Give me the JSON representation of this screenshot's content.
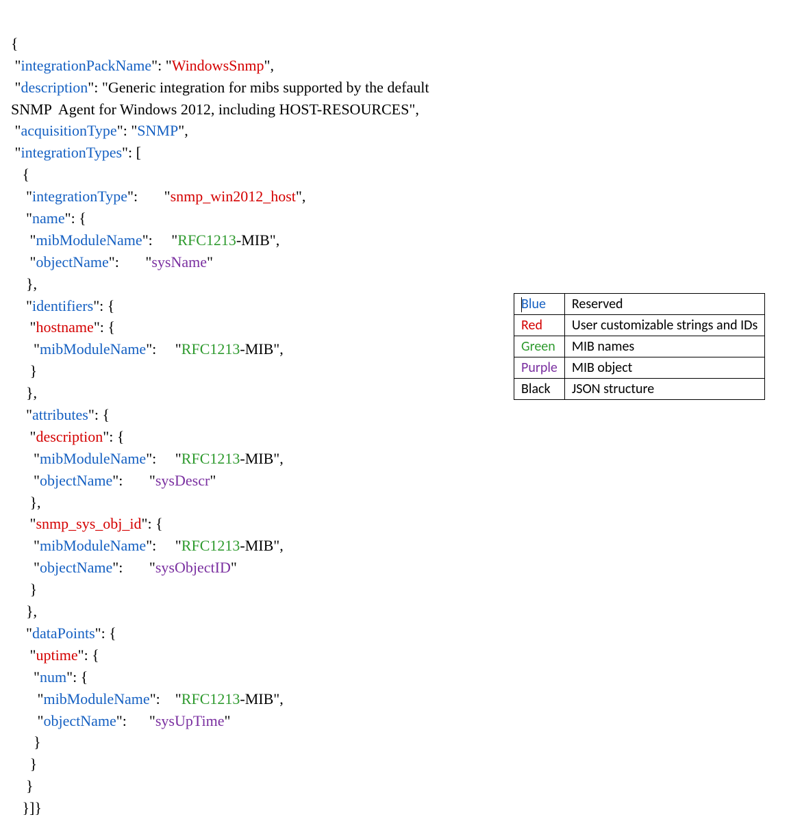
{
  "code": {
    "l1": "{",
    "l2_key": "integrationPackName",
    "l2_val": "WindowsSnmp",
    "l3_key": "description",
    "l3_val_a": "Generic integration for mibs supported by the default",
    "l3_val_b": "SNMP  Agent for Windows 2012, including HOST-RESOURCES",
    "l5_key": "acquisitionType",
    "l5_val": "SNMP",
    "l6_key": "integrationTypes",
    "l8_key": "integrationType",
    "l8_val": "snmp_win2012_host",
    "l9_key": "name",
    "mibModuleName_key": "mibModuleName",
    "objectName_key": "objectName",
    "mib_pre": "RFC1213",
    "mib_suf": "-MIB",
    "sysName": "sysName",
    "identifiers_key": "identifiers",
    "hostname_key": "hostname",
    "attributes_key": "attributes",
    "description_red": "description",
    "sysDescr": "sysDescr",
    "snmp_sys_obj_id": "snmp_sys_obj_id",
    "sysObjectID": "sysObjectID",
    "dataPoints_key": "dataPoints",
    "uptime_key": "uptime",
    "num_key": "num",
    "sysUpTime": "sysUpTime"
  },
  "legend": {
    "r1": {
      "color": "Blue",
      "desc": "Reserved"
    },
    "r2": {
      "color": "Red",
      "desc": "User customizable strings and IDs"
    },
    "r3": {
      "color": "Green",
      "desc": "MIB names"
    },
    "r4": {
      "color": "Purple",
      "desc": "MIB object"
    },
    "r5": {
      "color": "Black",
      "desc": "JSON structure"
    }
  }
}
